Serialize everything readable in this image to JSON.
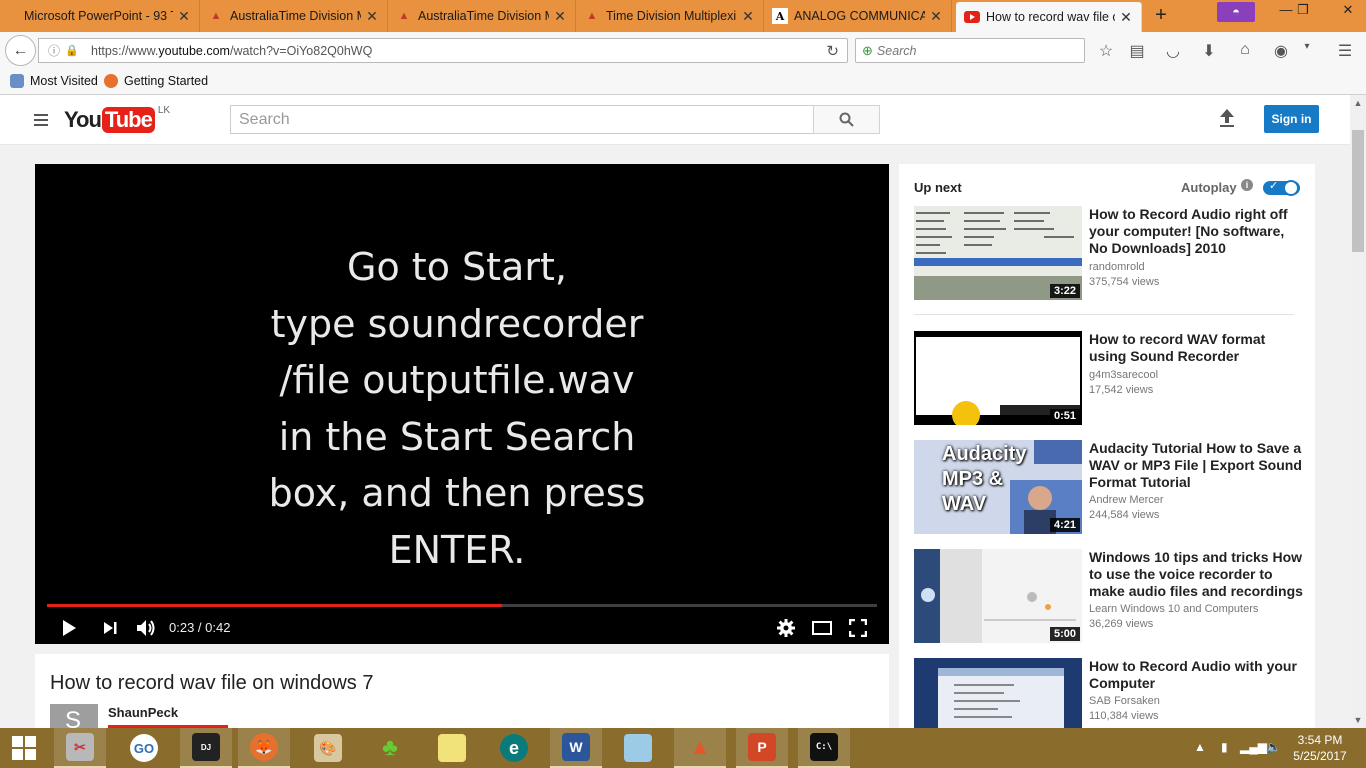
{
  "browser": {
    "tabs": [
      {
        "title": "Microsoft PowerPoint - 93 T",
        "icon": "powerpoint-icon"
      },
      {
        "title": "AustraliaTime Division M",
        "icon": "matlab-icon"
      },
      {
        "title": "AustraliaTime Division M",
        "icon": "matlab-icon"
      },
      {
        "title": "Time Division Multiplexi",
        "icon": "matlab-icon"
      },
      {
        "title": "ANALOG COMMUNICA",
        "icon": "wikipedia-icon"
      },
      {
        "title": "How to record wav file o",
        "icon": "youtube-icon",
        "active": true
      }
    ],
    "url_prefix": "https://www.",
    "url_domain": "youtube.com",
    "url_path": "/watch?v=OiYo82Q0hWQ",
    "search_placeholder": "Search",
    "bookmarks": [
      "Most Visited",
      "Getting Started"
    ]
  },
  "youtube": {
    "logo_you": "You",
    "logo_tube": "Tube",
    "country": "LK",
    "search_placeholder": "Search",
    "signin": "Sign in"
  },
  "player": {
    "caption_lines": [
      "Go to Start,",
      "type soundrecorder",
      "/file outputfile.wav",
      "in the Start Search",
      "box, and then press",
      "ENTER."
    ],
    "time_current": "0:23",
    "time_separator": " / ",
    "time_total": "0:42",
    "progress_fraction": 0.548
  },
  "video": {
    "title": "How to record wav file on windows 7",
    "channel": "ShaunPeck",
    "avatar_letter": "S"
  },
  "sidebar": {
    "up_next": "Up next",
    "autoplay": "Autoplay",
    "autoplay_on": true,
    "videos": [
      {
        "title": "How to Record Audio right off your computer! [No software, No Downloads] 2010",
        "channel": "randomrold",
        "views": "375,754 views",
        "duration": "3:22"
      },
      {
        "title": "How to record WAV format using Sound Recorder",
        "channel": "g4m3sarecool",
        "views": "17,542 views",
        "duration": "0:51"
      },
      {
        "title": "Audacity Tutorial How to Save a WAV or MP3 File | Export Sound Format Tutorial",
        "channel": "Andrew Mercer",
        "views": "244,584 views",
        "duration": "4:21",
        "thumb_text": [
          "Audacity",
          "MP3 &",
          "WAV"
        ]
      },
      {
        "title": "Windows 10 tips and tricks How to use the voice recorder to make audio files and recordings",
        "channel": "Learn Windows 10 and Computers",
        "views": "36,269 views",
        "duration": "5:00"
      },
      {
        "title": "How to Record Audio with your Computer",
        "channel": "SAB Forsaken",
        "views": "110,384 views",
        "duration": ""
      }
    ]
  },
  "taskbar": {
    "time": "3:54 PM",
    "date": "5/25/2017"
  },
  "colors": {
    "tabbar": "#e8913f",
    "youtube_red": "#e62117",
    "signin_blue": "#167ac6",
    "taskbar": "#8a6d2c"
  }
}
